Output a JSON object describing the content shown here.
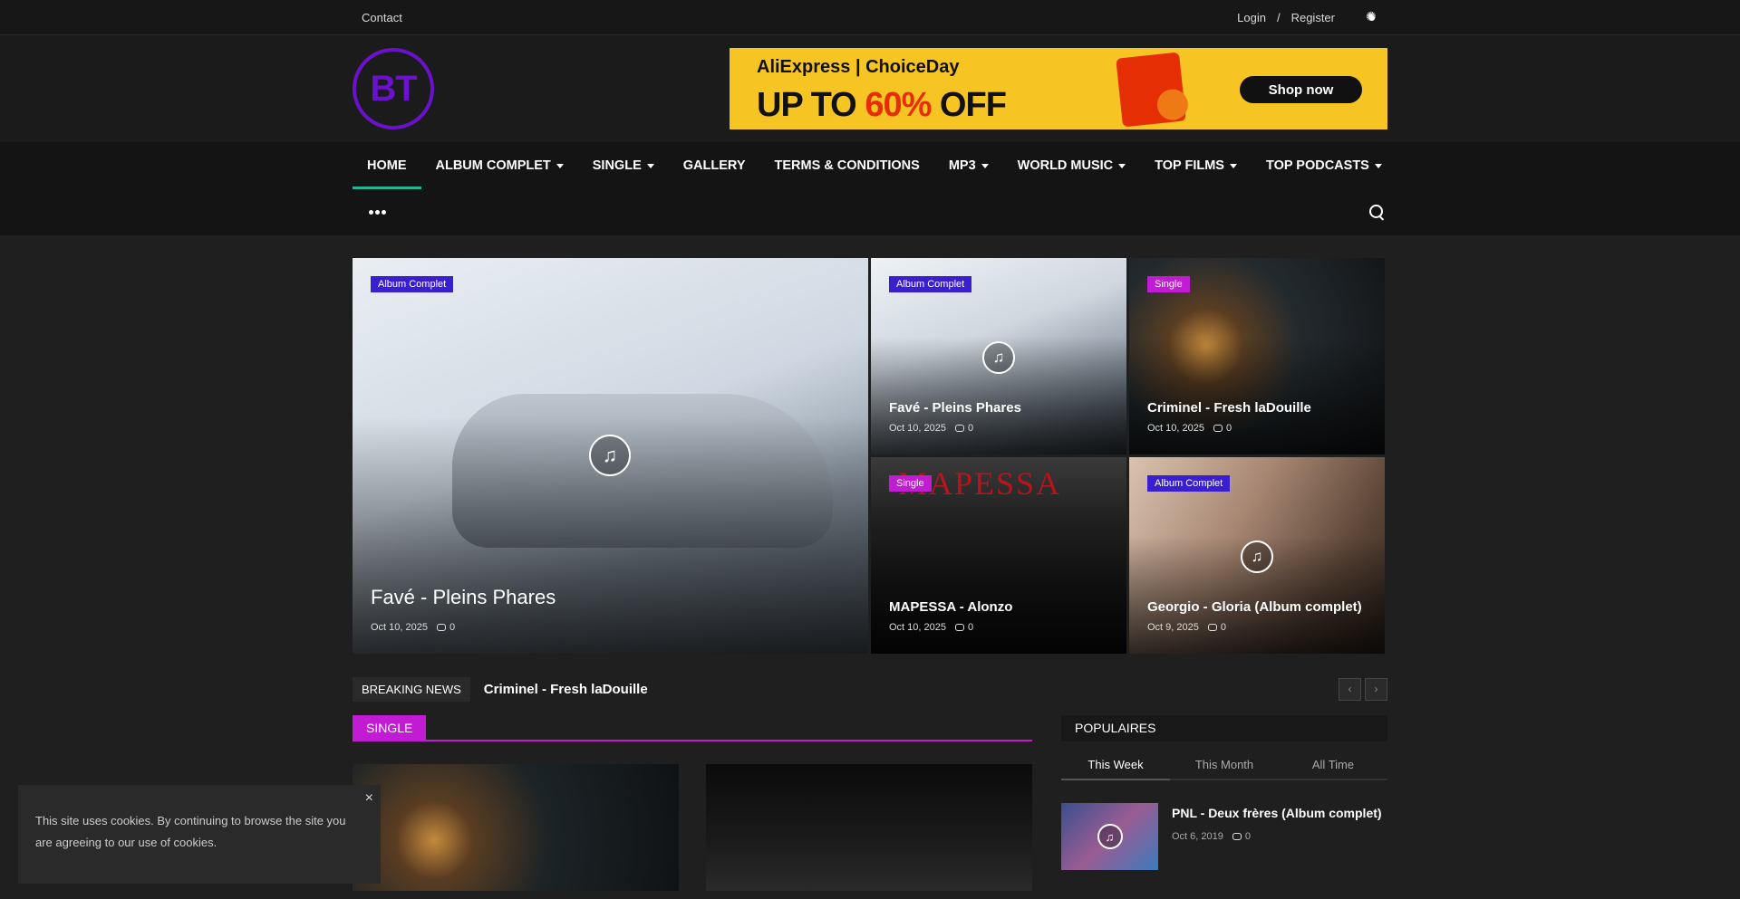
{
  "topbar": {
    "contact": "Contact",
    "login": "Login",
    "separator": "/",
    "register": "Register"
  },
  "header": {
    "logo_text": "BT",
    "banner": {
      "brand": "AliExpress | ChoiceDay",
      "deal_prefix": "UP TO ",
      "deal_percent": "60%",
      "deal_suffix": " OFF",
      "cta": "Shop now"
    }
  },
  "nav": {
    "items": [
      {
        "label": "HOME",
        "dropdown": false,
        "active": true
      },
      {
        "label": "ALBUM COMPLET",
        "dropdown": true
      },
      {
        "label": "SINGLE",
        "dropdown": true
      },
      {
        "label": "GALLERY",
        "dropdown": false
      },
      {
        "label": "TERMS & CONDITIONS",
        "dropdown": false
      },
      {
        "label": "MP3",
        "dropdown": true
      },
      {
        "label": "WORLD MUSIC",
        "dropdown": true
      },
      {
        "label": "TOP FILMS",
        "dropdown": true
      },
      {
        "label": "TOP PODCASTS",
        "dropdown": true
      }
    ]
  },
  "hero": [
    {
      "tag": "Album Complet",
      "tag_type": "album",
      "title": "Favé - Pleins Phares",
      "date": "Oct 10, 2025",
      "comments": "0"
    },
    {
      "tag": "Album Complet",
      "tag_type": "album",
      "title": "Favé - Pleins Phares",
      "date": "Oct 10, 2025",
      "comments": "0"
    },
    {
      "tag": "Single",
      "tag_type": "single",
      "title": "Criminel - Fresh laDouille",
      "date": "Oct 10, 2025",
      "comments": "0"
    },
    {
      "tag": "Single",
      "tag_type": "single",
      "title": "MAPESSA - Alonzo",
      "date": "Oct 10, 2025",
      "comments": "0"
    },
    {
      "tag": "Album Complet",
      "tag_type": "album",
      "title": "Georgio - Gloria (Album complet)",
      "date": "Oct 9, 2025",
      "comments": "0"
    }
  ],
  "breaking": {
    "label": "BREAKING NEWS",
    "item": "Criminel - Fresh laDouille",
    "prev": "‹",
    "next": "›"
  },
  "section": {
    "title": "SINGLE"
  },
  "popular": {
    "title": "POPULAIRES",
    "tabs": [
      "This Week",
      "This Month",
      "All Time"
    ],
    "items": [
      {
        "title": "PNL - Deux frères (Album complet)",
        "date": "Oct 6, 2019",
        "comments": "0"
      }
    ]
  },
  "cookie": {
    "text": "This site uses cookies. By continuing to browse the site you are agreeing to our use of cookies.",
    "close": "×"
  },
  "colors": {
    "accent_album": "#3a1fd1",
    "accent_single": "#c21bd4",
    "nav_active": "#22b593",
    "logo": "#6a11cb"
  }
}
